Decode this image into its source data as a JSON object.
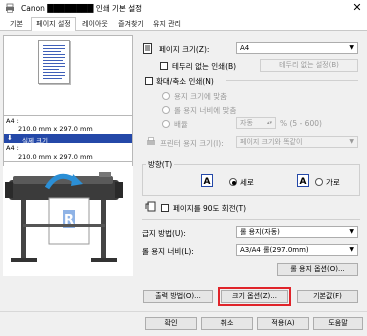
{
  "window": {
    "title": "Canon ████████ 인쇄 기본 설정",
    "close": "✕"
  },
  "tabs": [
    {
      "label": "기본"
    },
    {
      "label": "페이지 설정"
    },
    {
      "label": "레이아웃"
    },
    {
      "label": "즐겨찾기"
    },
    {
      "label": "유지 관리"
    }
  ],
  "preview": {
    "paper_label": "A4 :",
    "paper_size": "210.0 mm x 297.0 mm",
    "output_label": "실제 크기",
    "output_paper_label": "A4 :",
    "output_paper_size": "210.0 mm x 297.0 mm"
  },
  "page_size": {
    "label": "페이지 크기(Z):",
    "value": "A4"
  },
  "borderless": {
    "label": "테두리 없는 인쇄(B)",
    "button": "테두리 없는 설정(B)"
  },
  "scaling": {
    "label": "확대/축소 인쇄(N)",
    "fit_page": "용지 크기에 맞춤",
    "fit_roll": "롤 용지 너비에 맞춤",
    "scale_label": "배율",
    "scale_value": "자동",
    "scale_range": "% (5 - 600)",
    "printer_paper_label": "프린터 용지 크기(I):",
    "printer_paper_value": "페이지 크기와 똑같이"
  },
  "orientation": {
    "title": "방향(T)",
    "portrait": "세로",
    "landscape": "가로",
    "rotate180": "페이지를 90도 회전(T)"
  },
  "paper_source": {
    "label": "급지 방법(U):",
    "value": "롤 용지(자동)"
  },
  "roll_width": {
    "label": "롤 용지 너비(L):",
    "value": "A3/A4 롤(297.0mm)"
  },
  "buttons": {
    "roll_options": "롤 용지 옵션(O)...",
    "output_method": "출력 방법(O)...",
    "size_options": "크기 옵션(Z)...",
    "defaults": "기본값(F)",
    "ok": "확인",
    "cancel": "취소",
    "apply": "적용(A)",
    "help": "도움말"
  }
}
